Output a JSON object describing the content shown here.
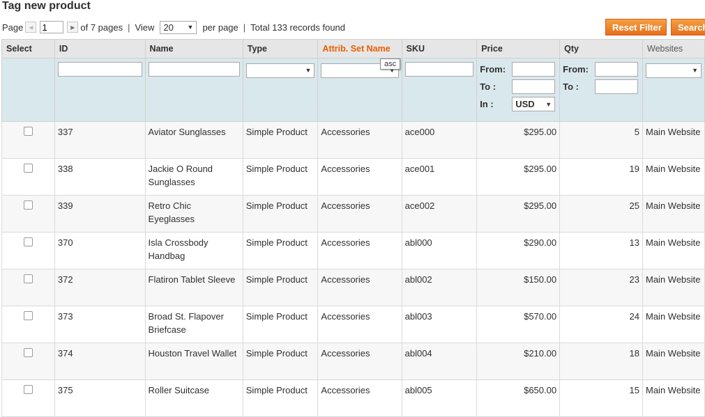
{
  "header": {
    "title": "Tag new product"
  },
  "pager": {
    "page_label": "Page",
    "page_value": "1",
    "of_pages": "of 7 pages",
    "sep": "|",
    "view_label": "View",
    "per_page_value": "20",
    "per_page_label": "per page",
    "sep2": "|",
    "total": "Total 133 records found"
  },
  "buttons": {
    "reset": "Reset Filter",
    "search": "Search"
  },
  "columns": {
    "select": "Select",
    "id": "ID",
    "name": "Name",
    "type": "Type",
    "attrib": "Attrib. Set Name",
    "sku": "SKU",
    "price": "Price",
    "qty": "Qty",
    "websites": "Websites"
  },
  "filters": {
    "from": "From:",
    "to": "To :",
    "in": "In :",
    "currency": "USD"
  },
  "tooltip": "asc",
  "rows": [
    {
      "id": "337",
      "name": "Aviator Sunglasses",
      "type": "Simple Product",
      "attrib": "Accessories",
      "sku": "ace000",
      "price": "$295.00",
      "qty": "5",
      "website": "Main Website"
    },
    {
      "id": "338",
      "name": "Jackie O Round Sunglasses",
      "type": "Simple Product",
      "attrib": "Accessories",
      "sku": "ace001",
      "price": "$295.00",
      "qty": "19",
      "website": "Main Website"
    },
    {
      "id": "339",
      "name": "Retro Chic Eyeglasses",
      "type": "Simple Product",
      "attrib": "Accessories",
      "sku": "ace002",
      "price": "$295.00",
      "qty": "25",
      "website": "Main Website"
    },
    {
      "id": "370",
      "name": "Isla Crossbody Handbag",
      "type": "Simple Product",
      "attrib": "Accessories",
      "sku": "abl000",
      "price": "$290.00",
      "qty": "13",
      "website": "Main Website"
    },
    {
      "id": "372",
      "name": "Flatiron Tablet Sleeve",
      "type": "Simple Product",
      "attrib": "Accessories",
      "sku": "abl002",
      "price": "$150.00",
      "qty": "23",
      "website": "Main Website"
    },
    {
      "id": "373",
      "name": "Broad St. Flapover Briefcase",
      "type": "Simple Product",
      "attrib": "Accessories",
      "sku": "abl003",
      "price": "$570.00",
      "qty": "24",
      "website": "Main Website"
    },
    {
      "id": "374",
      "name": "Houston Travel Wallet",
      "type": "Simple Product",
      "attrib": "Accessories",
      "sku": "abl004",
      "price": "$210.00",
      "qty": "18",
      "website": "Main Website"
    },
    {
      "id": "375",
      "name": "Roller Suitcase",
      "type": "Simple Product",
      "attrib": "Accessories",
      "sku": "abl005",
      "price": "$650.00",
      "qty": "15",
      "website": "Main Website"
    }
  ]
}
